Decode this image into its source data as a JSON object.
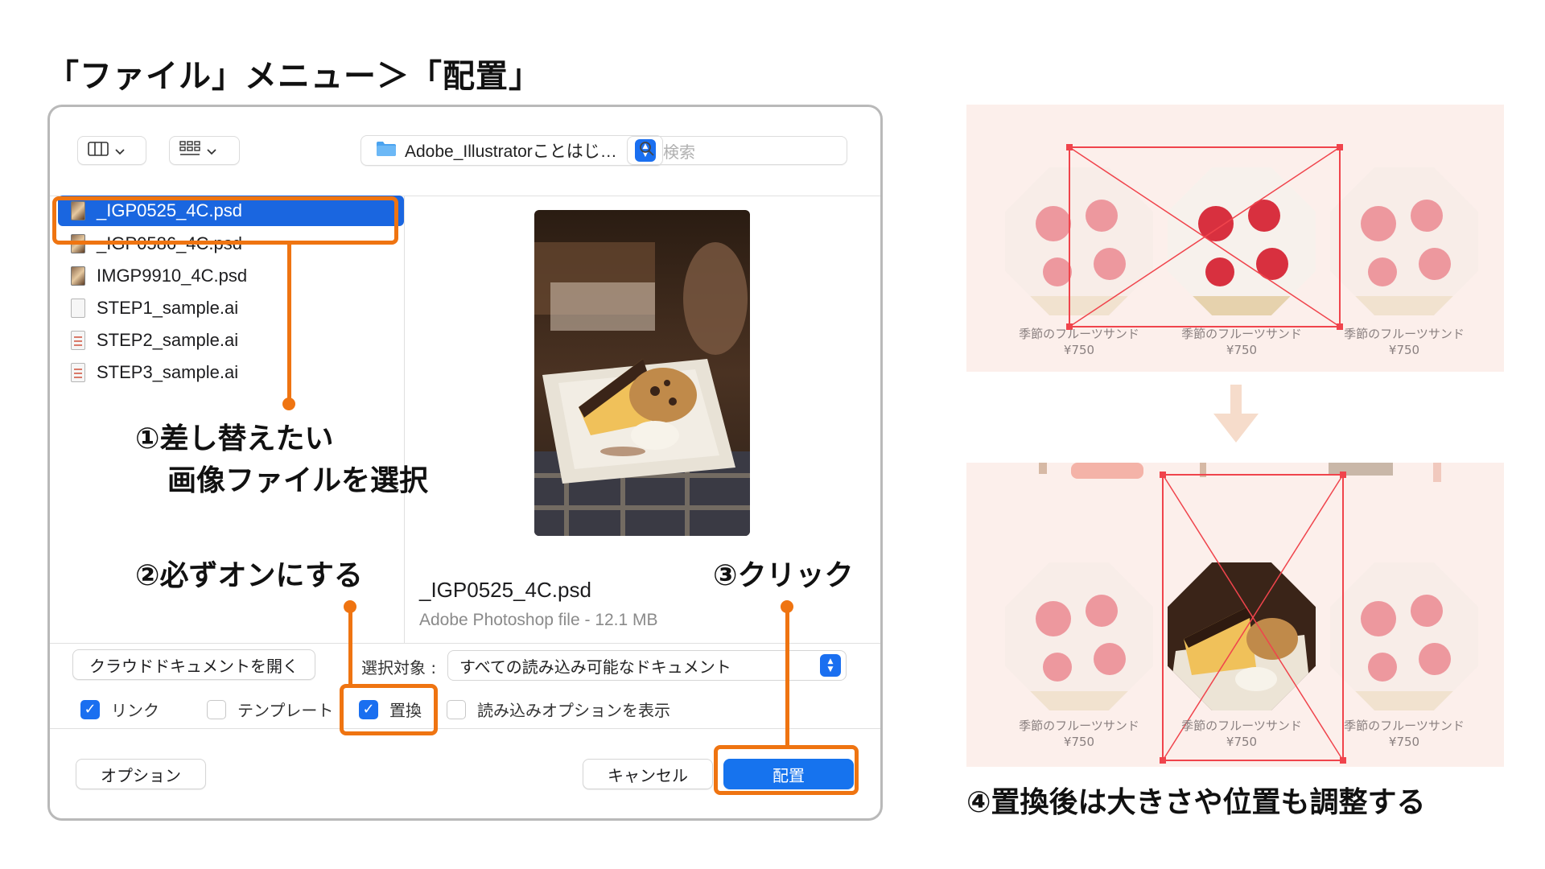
{
  "page_title": "「ファイル」メニュー＞「配置」",
  "dialog": {
    "toolbar": {
      "view_button_icon": "columns-view-icon",
      "grid_button_icon": "grid-view-icon",
      "path_label": "Adobe_Illustratorことはじ…",
      "search_placeholder": "検索"
    },
    "files": [
      {
        "name": "_IGP0525_4C.psd",
        "icon": "photo-file-icon",
        "selected": true
      },
      {
        "name": "_IGP0586_4C.psd",
        "icon": "photo-file-icon",
        "selected": false
      },
      {
        "name": "IMGP9910_4C.psd",
        "icon": "photo-file-icon",
        "selected": false
      },
      {
        "name": "STEP1_sample.ai",
        "icon": "document-file-icon",
        "selected": false
      },
      {
        "name": "STEP2_sample.ai",
        "icon": "document-file-icon",
        "selected": false
      },
      {
        "name": "STEP3_sample.ai",
        "icon": "document-file-icon",
        "selected": false
      }
    ],
    "preview": {
      "filename": "_IGP0525_4C.psd",
      "meta": "Adobe Photoshop file - 12.1 MB"
    },
    "cloud_button": "クラウドドキュメントを開く",
    "filter_label": "選択対象 :",
    "filter_value": "すべての読み込み可能なドキュメント",
    "checkboxes": [
      {
        "label": "リンク",
        "checked": true
      },
      {
        "label": "テンプレート",
        "checked": false
      },
      {
        "label": "置換",
        "checked": true
      },
      {
        "label": "読み込みオプションを表示",
        "checked": false
      }
    ],
    "options_button": "オプション",
    "cancel_button": "キャンセル",
    "place_button": "配置"
  },
  "annotations": {
    "step1_line1": "①差し替えたい",
    "step1_line2": "画像ファイルを選択",
    "step2": "②必ずオンにする",
    "step3": "③クリック",
    "step4": "④置換後は大きさや位置も調整する"
  },
  "colors": {
    "accent_orange": "#ef7411",
    "selection_blue": "#1a66e0",
    "panel_bg": "#fcefeb",
    "guide_red": "#f0444c"
  },
  "panels": {
    "before": {
      "items": [
        {
          "name": "季節のフルーツサンド",
          "price": "¥750"
        },
        {
          "name": "季節のフルーツサンド",
          "price": "¥750"
        },
        {
          "name": "季節のフルーツサンド",
          "price": "¥750"
        }
      ]
    },
    "after": {
      "items": [
        {
          "name": "季節のフルーツサンド",
          "price": "¥750"
        },
        {
          "name": "季節のフルーツサンド",
          "price": "¥750"
        },
        {
          "name": "季節のフルーツサンド",
          "price": "¥750"
        }
      ]
    }
  }
}
